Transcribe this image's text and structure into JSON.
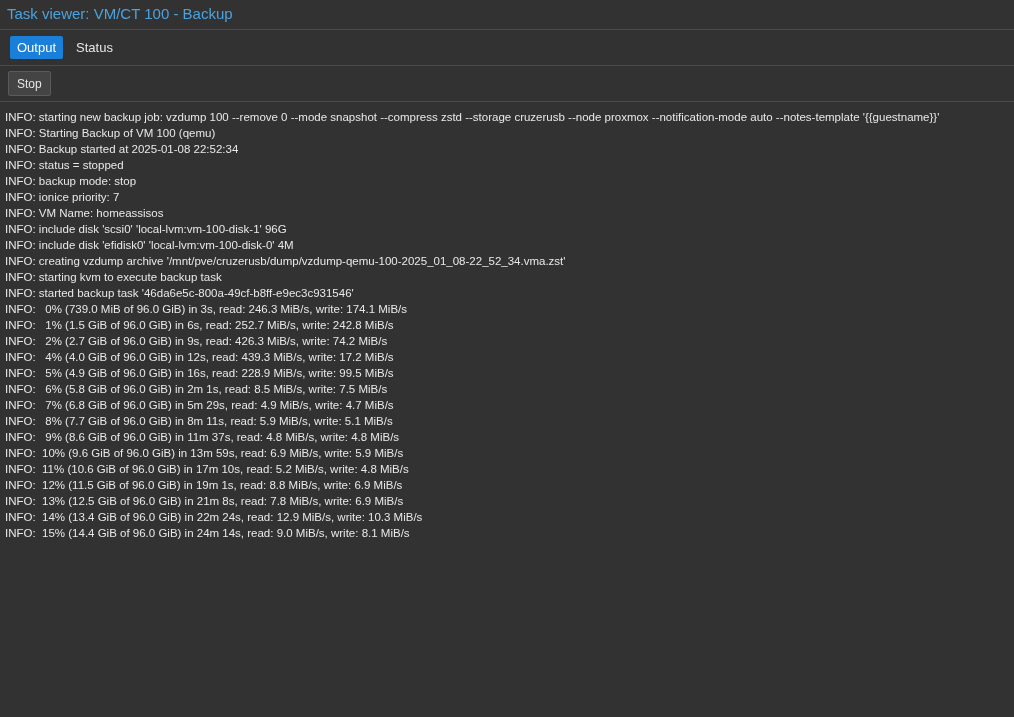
{
  "window": {
    "title": "Task viewer: VM/CT 100 - Backup"
  },
  "tabs": [
    {
      "label": "Output",
      "selected": true
    },
    {
      "label": "Status",
      "selected": false
    }
  ],
  "toolbar": {
    "buttons": [
      "Stop"
    ]
  },
  "log": {
    "lines": [
      "INFO: starting new backup job: vzdump 100 --remove 0 --mode snapshot --compress zstd --storage cruzerusb --node proxmox --notification-mode auto --notes-template '{{guestname}}'",
      "INFO: Starting Backup of VM 100 (qemu)",
      "INFO: Backup started at 2025-01-08 22:52:34",
      "INFO: status = stopped",
      "INFO: backup mode: stop",
      "INFO: ionice priority: 7",
      "INFO: VM Name: homeassisos",
      "INFO: include disk 'scsi0' 'local-lvm:vm-100-disk-1' 96G",
      "INFO: include disk 'efidisk0' 'local-lvm:vm-100-disk-0' 4M",
      "INFO: creating vzdump archive '/mnt/pve/cruzerusb/dump/vzdump-qemu-100-2025_01_08-22_52_34.vma.zst'",
      "INFO: starting kvm to execute backup task",
      "INFO: started backup task '46da6e5c-800a-49cf-b8ff-e9ec3c931546'",
      "INFO:   0% (739.0 MiB of 96.0 GiB) in 3s, read: 246.3 MiB/s, write: 174.1 MiB/s",
      "INFO:   1% (1.5 GiB of 96.0 GiB) in 6s, read: 252.7 MiB/s, write: 242.8 MiB/s",
      "INFO:   2% (2.7 GiB of 96.0 GiB) in 9s, read: 426.3 MiB/s, write: 74.2 MiB/s",
      "INFO:   4% (4.0 GiB of 96.0 GiB) in 12s, read: 439.3 MiB/s, write: 17.2 MiB/s",
      "INFO:   5% (4.9 GiB of 96.0 GiB) in 16s, read: 228.9 MiB/s, write: 99.5 MiB/s",
      "INFO:   6% (5.8 GiB of 96.0 GiB) in 2m 1s, read: 8.5 MiB/s, write: 7.5 MiB/s",
      "INFO:   7% (6.8 GiB of 96.0 GiB) in 5m 29s, read: 4.9 MiB/s, write: 4.7 MiB/s",
      "INFO:   8% (7.7 GiB of 96.0 GiB) in 8m 11s, read: 5.9 MiB/s, write: 5.1 MiB/s",
      "INFO:   9% (8.6 GiB of 96.0 GiB) in 11m 37s, read: 4.8 MiB/s, write: 4.8 MiB/s",
      "INFO:  10% (9.6 GiB of 96.0 GiB) in 13m 59s, read: 6.9 MiB/s, write: 5.9 MiB/s",
      "INFO:  11% (10.6 GiB of 96.0 GiB) in 17m 10s, read: 5.2 MiB/s, write: 4.8 MiB/s",
      "INFO:  12% (11.5 GiB of 96.0 GiB) in 19m 1s, read: 8.8 MiB/s, write: 6.9 MiB/s",
      "INFO:  13% (12.5 GiB of 96.0 GiB) in 21m 8s, read: 7.8 MiB/s, write: 6.9 MiB/s",
      "INFO:  14% (13.4 GiB of 96.0 GiB) in 22m 24s, read: 12.9 MiB/s, write: 10.3 MiB/s",
      "INFO:  15% (14.4 GiB of 96.0 GiB) in 24m 14s, read: 9.0 MiB/s, write: 8.1 MiB/s"
    ]
  }
}
